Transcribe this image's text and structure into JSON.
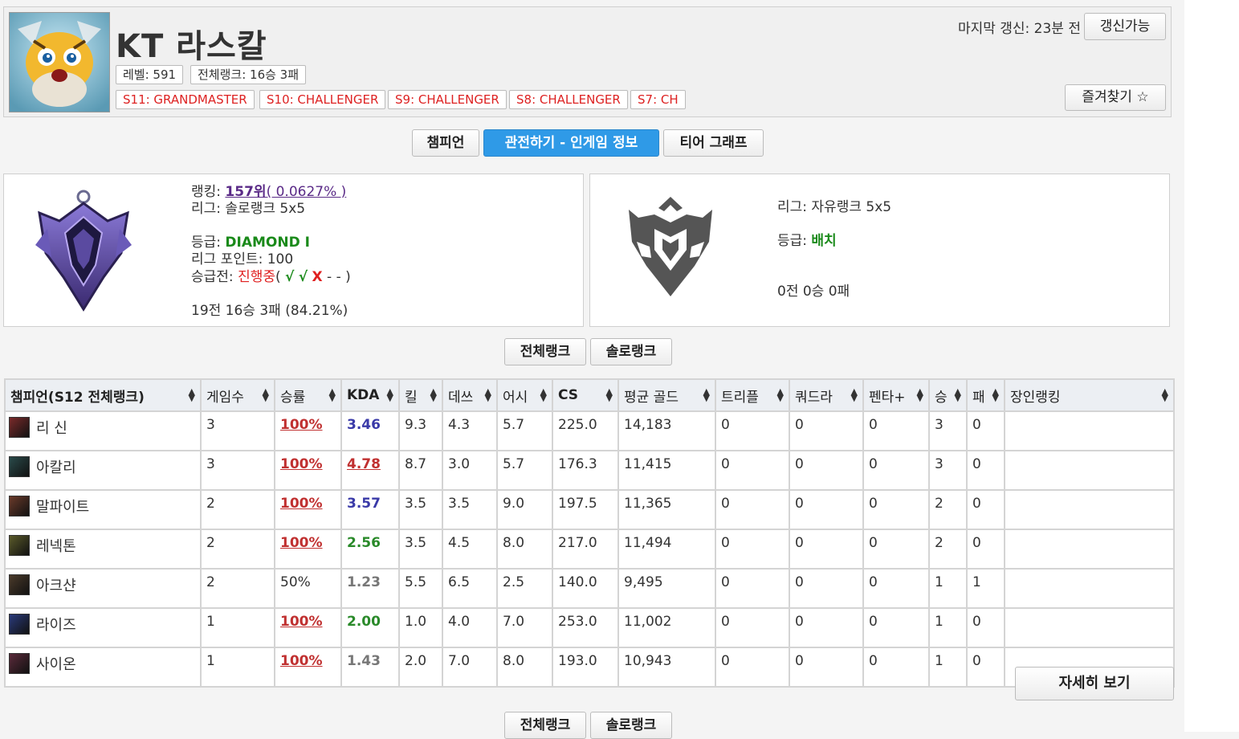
{
  "header": {
    "summoner_name": "KT 라스칼",
    "level_badge": "레벨: 591",
    "overall_rank_badge": "전체랭크: 16승 3패",
    "season_badges": [
      "S11: GRANDMASTER",
      "S10: CHALLENGER",
      "S9: CHALLENGER",
      "S8: CHALLENGER",
      "S7: CH"
    ],
    "last_update": "마지막 갱신: 23분 전",
    "update_button": "갱신가능",
    "favorite_button": "즐겨찾기 ☆"
  },
  "tabs": [
    {
      "label": "챔피언",
      "active": false
    },
    {
      "label": "관전하기 - 인게임 정보",
      "active": true
    },
    {
      "label": "티어 그래프",
      "active": false
    }
  ],
  "solo_rank": {
    "ranking_label": "랭킹: ",
    "ranking_value": "157위",
    "ranking_percent": "( 0.0627% )",
    "league": "리그: 솔로랭크 5x5",
    "tier_label": "등급: ",
    "tier_value": "DIAMOND I",
    "lp": "리그 포인트: 100",
    "promo_label": "승급전: ",
    "promo_status": "진행중",
    "promo_open": "( ",
    "promo_w1": "√",
    "promo_w2": "√",
    "promo_l1": "X",
    "promo_rest": "- - )",
    "record": "19전 16승 3패 (84.21%)"
  },
  "flex_rank": {
    "league": "리그: 자유랭크 5x5",
    "tier_label": "등급: ",
    "tier_value": "배치",
    "record": "0전 0승 0패"
  },
  "rank_filter_buttons": [
    "전체랭크",
    "솔로랭크"
  ],
  "table": {
    "headers": [
      "챔피언(S12 전체랭크)",
      "게임수",
      "승률",
      "KDA",
      "킬",
      "데쓰",
      "어시",
      "CS",
      "평균 골드",
      "트리플",
      "쿼드라",
      "펜타+",
      "승",
      "패",
      "장인랭킹"
    ],
    "rows": [
      {
        "champion": "리 신",
        "games": "3",
        "winrate": "100%",
        "kda": "3.46",
        "kda_color": "#3a3aa8",
        "kills": "9.3",
        "deaths": "4.3",
        "assists": "5.7",
        "cs": "225.0",
        "gold": "14,183",
        "triple": "0",
        "quadra": "0",
        "penta": "0",
        "wins": "3",
        "losses": "0",
        "mastery": "",
        "icon_color": "#7a2a2a"
      },
      {
        "champion": "아칼리",
        "games": "3",
        "winrate": "100%",
        "kda": "4.78",
        "kda_color": "#c03030",
        "kills": "8.7",
        "deaths": "3.0",
        "assists": "5.7",
        "cs": "176.3",
        "gold": "11,415",
        "triple": "0",
        "quadra": "0",
        "penta": "0",
        "wins": "3",
        "losses": "0",
        "mastery": "",
        "icon_color": "#2a4a4a"
      },
      {
        "champion": "말파이트",
        "games": "2",
        "winrate": "100%",
        "kda": "3.57",
        "kda_color": "#3a3aa8",
        "kills": "3.5",
        "deaths": "3.5",
        "assists": "9.0",
        "cs": "197.5",
        "gold": "11,365",
        "triple": "0",
        "quadra": "0",
        "penta": "0",
        "wins": "2",
        "losses": "0",
        "mastery": "",
        "icon_color": "#6a3a2a"
      },
      {
        "champion": "레넥톤",
        "games": "2",
        "winrate": "100%",
        "kda": "2.56",
        "kda_color": "#2a8a2a",
        "kills": "3.5",
        "deaths": "4.5",
        "assists": "8.0",
        "cs": "217.0",
        "gold": "11,494",
        "triple": "0",
        "quadra": "0",
        "penta": "0",
        "wins": "2",
        "losses": "0",
        "mastery": "",
        "icon_color": "#5a5a2a"
      },
      {
        "champion": "아크샨",
        "games": "2",
        "winrate": "50%",
        "kda": "1.23",
        "kda_color": "#777777",
        "kills": "5.5",
        "deaths": "6.5",
        "assists": "2.5",
        "cs": "140.0",
        "gold": "9,495",
        "triple": "0",
        "quadra": "0",
        "penta": "0",
        "wins": "1",
        "losses": "1",
        "mastery": "",
        "icon_color": "#4a3a2a"
      },
      {
        "champion": "라이즈",
        "games": "1",
        "winrate": "100%",
        "kda": "2.00",
        "kda_color": "#2a8a2a",
        "kills": "1.0",
        "deaths": "4.0",
        "assists": "7.0",
        "cs": "253.0",
        "gold": "11,002",
        "triple": "0",
        "quadra": "0",
        "penta": "0",
        "wins": "1",
        "losses": "0",
        "mastery": "",
        "icon_color": "#2a3a7a"
      },
      {
        "champion": "사이온",
        "games": "1",
        "winrate": "100%",
        "kda": "1.43",
        "kda_color": "#777777",
        "kills": "2.0",
        "deaths": "7.0",
        "assists": "8.0",
        "cs": "193.0",
        "gold": "10,943",
        "triple": "0",
        "quadra": "0",
        "penta": "0",
        "wins": "1",
        "losses": "0",
        "mastery": "",
        "icon_color": "#5a2a3a"
      }
    ]
  },
  "detail_button": "자세히 보기"
}
